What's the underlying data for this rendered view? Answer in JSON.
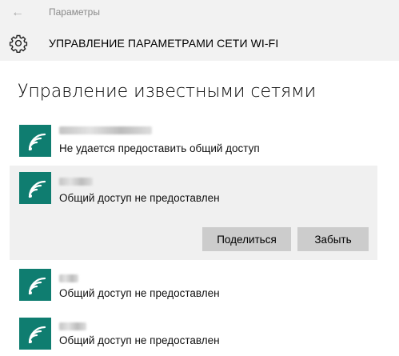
{
  "window": {
    "title": "Параметры"
  },
  "header": {
    "title": "УПРАВЛЕНИЕ ПАРАМЕТРАМИ СЕТИ WI-FI"
  },
  "section": {
    "title": "Управление известными сетями"
  },
  "networks": [
    {
      "status": "Не удается предоставить общий доступ"
    },
    {
      "status": "Общий доступ не предоставлен",
      "selected": true
    },
    {
      "status": "Общий доступ не предоставлен"
    },
    {
      "status": "Общий доступ не предоставлен"
    }
  ],
  "actions": {
    "share_label": "Поделиться",
    "forget_label": "Забыть"
  },
  "colors": {
    "tile": "#0f7d70",
    "selection": "#f0f0f0",
    "button": "#cccccc",
    "header_bg": "#f2f2f2"
  },
  "icons": {
    "back": "arrow-left-icon",
    "settings": "gear-icon",
    "network": "wifi-icon"
  }
}
